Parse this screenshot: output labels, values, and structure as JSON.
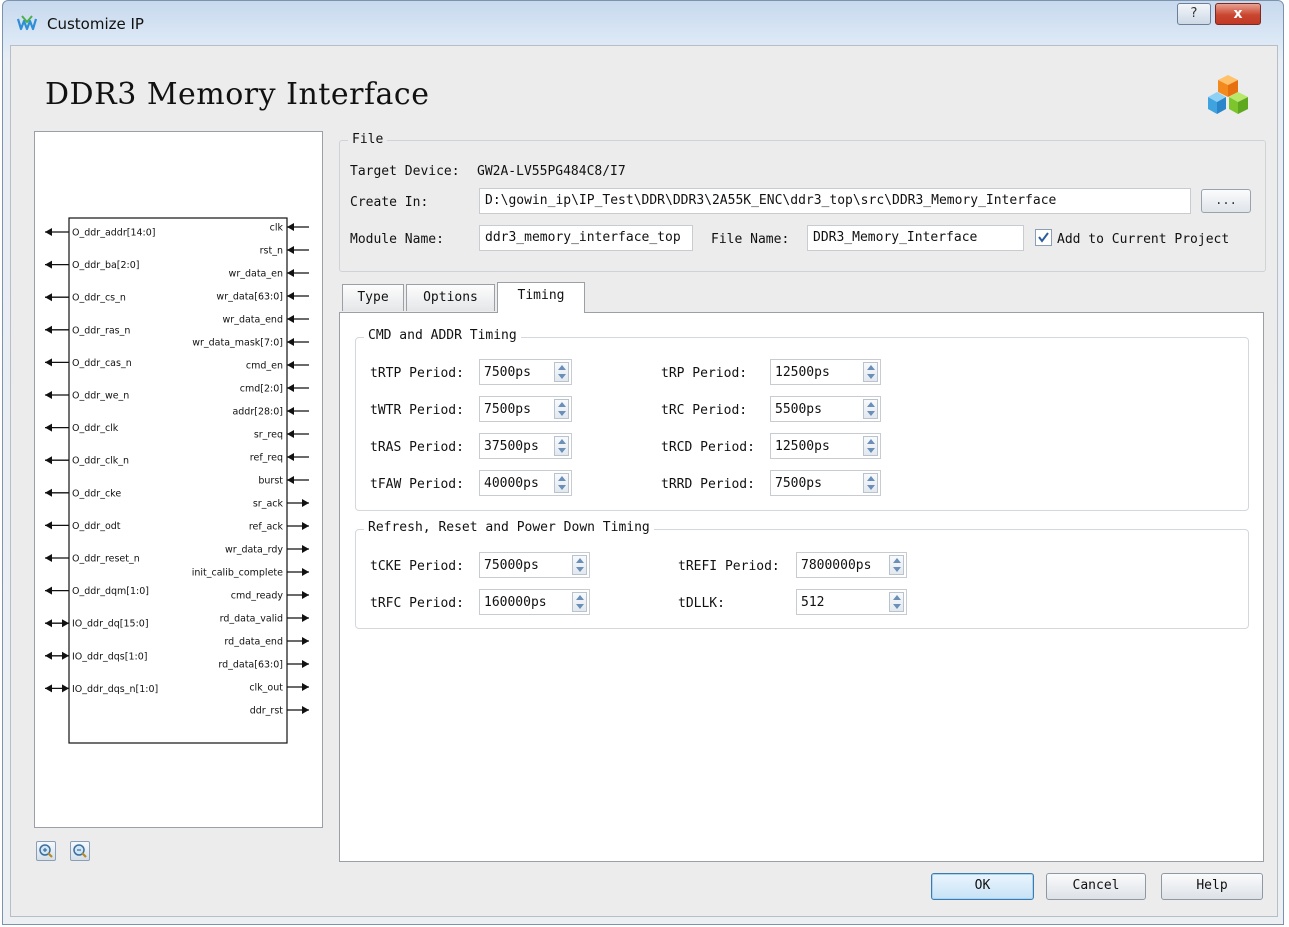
{
  "window": {
    "title": "Customize IP",
    "help_glyph": "?",
    "close_glyph": "x"
  },
  "page": {
    "heading": "DDR3 Memory Interface"
  },
  "diagram": {
    "left_pins": [
      "O_ddr_addr[14:0]",
      "O_ddr_ba[2:0]",
      "O_ddr_cs_n",
      "O_ddr_ras_n",
      "O_ddr_cas_n",
      "O_ddr_we_n",
      "O_ddr_clk",
      "O_ddr_clk_n",
      "O_ddr_cke",
      "O_ddr_odt",
      "O_ddr_reset_n",
      "O_ddr_dqm[1:0]",
      "IO_ddr_dq[15:0]",
      "IO_ddr_dqs[1:0]",
      "IO_ddr_dqs_n[1:0]"
    ],
    "right_inputs": [
      "clk",
      "rst_n",
      "wr_data_en",
      "wr_data[63:0]",
      "wr_data_end",
      "wr_data_mask[7:0]",
      "cmd_en",
      "cmd[2:0]",
      "addr[28:0]",
      "sr_req",
      "ref_req",
      "burst"
    ],
    "right_outputs": [
      "sr_ack",
      "ref_ack",
      "wr_data_rdy",
      "init_calib_complete",
      "cmd_ready",
      "rd_data_valid",
      "rd_data_end",
      "rd_data[63:0]",
      "clk_out",
      "ddr_rst"
    ],
    "zoom_in_icon": "zoom-in-icon",
    "zoom_out_icon": "zoom-out-icon"
  },
  "file": {
    "legend": "File",
    "target_device_label": "Target Device:",
    "target_device_value": "GW2A-LV55PG484C8/I7",
    "create_in_label": "Create In:",
    "create_in_value": "D:\\gowin_ip\\IP_Test\\DDR\\DDR3\\2A55K_ENC\\ddr3_top\\src\\DDR3_Memory_Interface",
    "browse_label": "...",
    "module_name_label": "Module Name:",
    "module_name_value": "ddr3_memory_interface_top",
    "file_name_label": "File Name:",
    "file_name_value": "DDR3_Memory_Interface",
    "add_to_project_label": "Add to Current Project",
    "add_to_project_checked": true
  },
  "tabs": [
    {
      "label": "Type",
      "active": false
    },
    {
      "label": "Options",
      "active": false
    },
    {
      "label": "Timing",
      "active": true
    }
  ],
  "cmd_addr_timing": {
    "legend": "CMD and ADDR Timing",
    "trtp": {
      "label": "tRTP Period:",
      "value": "7500ps"
    },
    "twtr": {
      "label": "tWTR Period:",
      "value": "7500ps"
    },
    "tras": {
      "label": "tRAS Period:",
      "value": "37500ps"
    },
    "tfaw": {
      "label": "tFAW Period:",
      "value": "40000ps"
    },
    "trp": {
      "label": "tRP Period:",
      "value": "12500ps"
    },
    "trc": {
      "label": "tRC Period:",
      "value": "5500ps"
    },
    "trcd": {
      "label": "tRCD Period:",
      "value": "12500ps"
    },
    "trrd": {
      "label": "tRRD Period:",
      "value": "7500ps"
    }
  },
  "refresh_timing": {
    "legend": "Refresh, Reset and Power Down Timing",
    "tcke": {
      "label": "tCKE Period:",
      "value": "75000ps"
    },
    "trfc": {
      "label": "tRFC Period:",
      "value": "160000ps"
    },
    "trefi": {
      "label": "tREFI Period:",
      "value": "7800000ps"
    },
    "tdllk": {
      "label": "tDLLK:",
      "value": "512"
    }
  },
  "buttons": {
    "ok": "OK",
    "cancel": "Cancel",
    "help": "Help"
  }
}
